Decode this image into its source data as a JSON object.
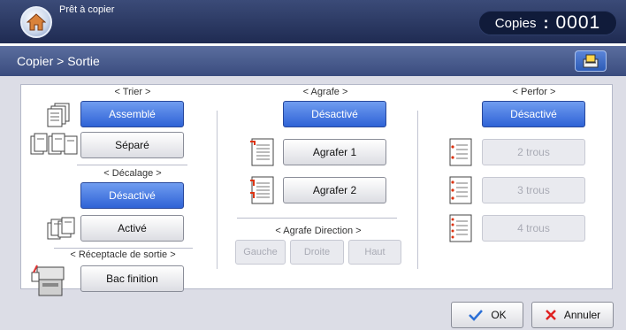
{
  "status": {
    "text": "Prêt à copier",
    "copies_label": "Copies",
    "copies_sep": ":",
    "copies_value": "0001"
  },
  "breadcrumb": "Copier > Sortie",
  "trier": {
    "header": "< Trier >",
    "assemble": "Assemblé",
    "separe": "Séparé"
  },
  "decalage": {
    "header": "< Décalage >",
    "desactive": "Désactivé",
    "active": "Activé"
  },
  "receptacle": {
    "header": "< Réceptacle de sortie >",
    "bac": "Bac finition"
  },
  "agrafe": {
    "header": "< Agrafe >",
    "desactive": "Désactivé",
    "agrafer1": "Agrafer 1",
    "agrafer2": "Agrafer 2"
  },
  "agrafe_direction": {
    "header": "< Agrafe Direction >",
    "gauche": "Gauche",
    "droite": "Droite",
    "haut": "Haut"
  },
  "perfor": {
    "header": "< Perfor >",
    "desactive": "Désactivé",
    "trous2": "2 trous",
    "trous3": "3 trous",
    "trous4": "4 trous"
  },
  "footer": {
    "ok": "OK",
    "annuler": "Annuler"
  },
  "colors": {
    "selected": "#2f63d6",
    "topbar": "#1f2b52",
    "cancel_x": "#e02020",
    "ok_check": "#2b6fd6"
  }
}
